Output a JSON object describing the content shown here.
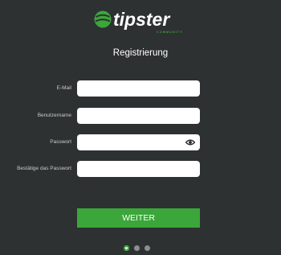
{
  "brand": {
    "name": "tipster",
    "tagline": "COMMUNITY",
    "accent_color": "#3ba63a"
  },
  "page_title": "Registrierung",
  "fields": {
    "email": {
      "label": "E-Mail",
      "value": "",
      "placeholder": ""
    },
    "username": {
      "label": "Benutzername",
      "value": "",
      "placeholder": ""
    },
    "password": {
      "label": "Passwort",
      "value": "",
      "placeholder": "",
      "icon": "eye-icon"
    },
    "password_confirm": {
      "label": "Bestätige das Passwort",
      "value": "",
      "placeholder": ""
    }
  },
  "submit_label": "WEITER",
  "pager": {
    "count": 3,
    "active_index": 1
  }
}
